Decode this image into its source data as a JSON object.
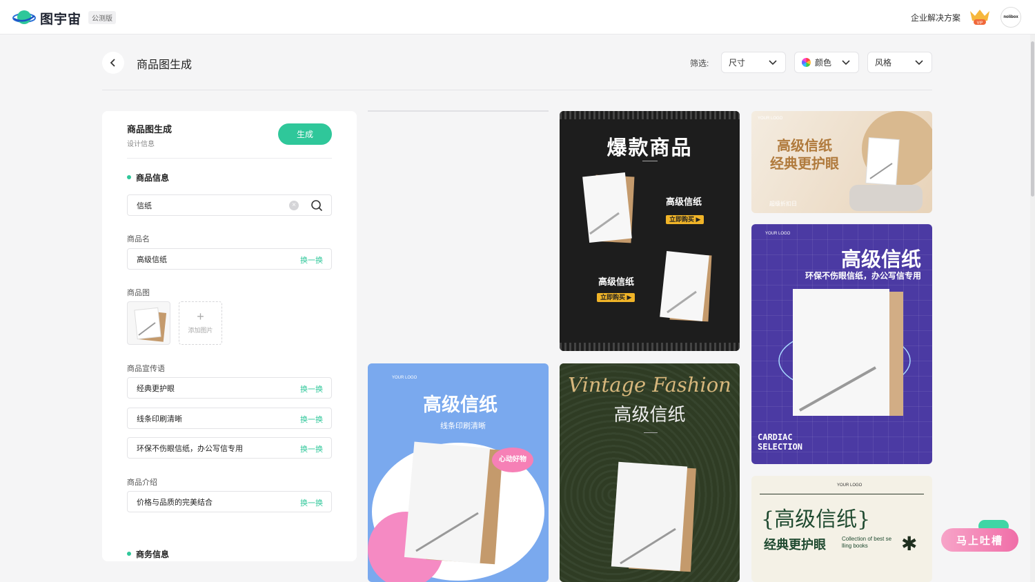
{
  "topbar": {
    "brand": "图宇宙",
    "beta_badge": "公测版",
    "enterprise_link": "企业解决方案",
    "vip_label": "VIP",
    "avatar_text": "nolibox"
  },
  "header": {
    "title": "商品图生成",
    "filter_label": "筛选:",
    "filters": {
      "size": "尺寸",
      "color": "颜色",
      "style": "风格"
    }
  },
  "panel": {
    "title": "商品图生成",
    "subtitle": "设计信息",
    "generate_label": "生成",
    "section_product": "商品信息",
    "search_value": "信纸",
    "name_label": "商品名",
    "name_value": "高级信纸",
    "swap_label": "换一换",
    "image_label": "商品图",
    "add_image_label": "添加图片",
    "slogan_label": "商品宣传语",
    "slogans": [
      "经典更护眼",
      "线条印刷清晰",
      "环保不伤眼信纸，办公写信专用"
    ],
    "intro_label": "商品介绍",
    "intro_value": "价格与品质的完美结合",
    "section_business": "商务信息"
  },
  "cards": {
    "c1": {
      "title": "爆款商品",
      "product1": "高级信纸",
      "product2": "高级信纸",
      "buy": "立即购买 ▶"
    },
    "c2": {
      "line1": "高级信纸",
      "line2": "经典更护眼",
      "logo": "YOUR LOGO",
      "promo": "超级折扣日"
    },
    "c3": {
      "logo": "YOUR LOGO",
      "title": "高级信纸",
      "sub": "环保不伤眼信纸，办公写信专用",
      "bottom1": "CARDIAC",
      "bottom2": "SELECTION"
    },
    "c4": {
      "logo": "YOUR LOGO",
      "title": "高级信纸",
      "sub": "线条印刷清晰",
      "badge": "心动好物"
    },
    "c5": {
      "script": "Vintage Fashion",
      "title": "高级信纸"
    },
    "c6": {
      "logo": "YOUR LOGO",
      "title": "{高级信纸}",
      "sub": "经典更护眼",
      "en1": "Collection of best se",
      "en2": "lling books"
    }
  },
  "feedback": {
    "label": "马上吐槽"
  },
  "colors": {
    "accent": "#2fc79a",
    "purple": "#4b3aa3",
    "blue": "#7aa9ee"
  }
}
